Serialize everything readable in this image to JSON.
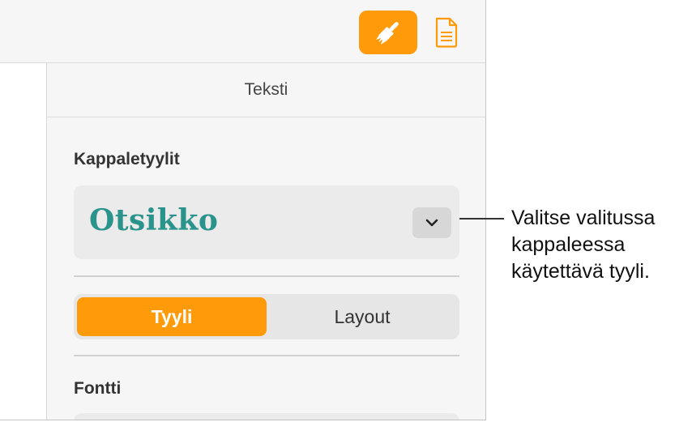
{
  "toolbar": {
    "format_button_icon": "paintbrush-icon",
    "document_button_icon": "document-icon",
    "accent_color": "#ff9a0a"
  },
  "sidebar": {
    "tab_title": "Teksti",
    "paragraph_styles_label": "Kappaletyylit",
    "selected_style": "Otsikko",
    "style_color": "#2a948c",
    "segments": [
      "Tyyli",
      "Layout"
    ],
    "active_segment": "Tyyli",
    "font_label": "Fontti"
  },
  "callout": {
    "lines": [
      "Valitse valitussa",
      "kappaleessa",
      "käytettävä tyyli."
    ]
  }
}
